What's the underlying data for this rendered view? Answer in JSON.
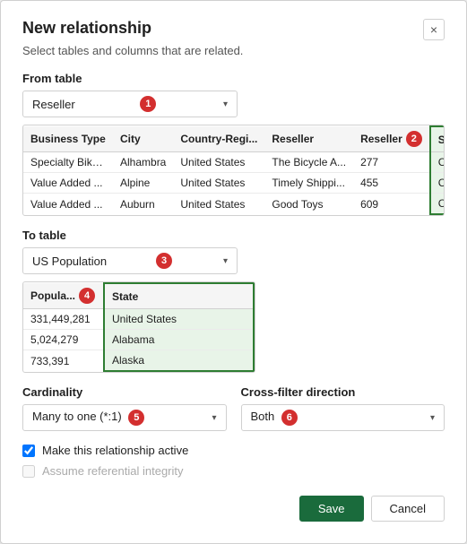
{
  "dialog": {
    "title": "New relationship",
    "subtitle": "Select tables and columns that are related.",
    "close_label": "×"
  },
  "from_table": {
    "label": "From table",
    "selected": "Reseller",
    "badge": "1",
    "columns": [
      "Business Type",
      "City",
      "Country-Regi...",
      "Reseller",
      "Reseller",
      "State-Province"
    ],
    "rows": [
      [
        "Specialty Bike...",
        "Alhambra",
        "United States",
        "The Bicycle A...",
        "277",
        "California"
      ],
      [
        "Value Added ...",
        "Alpine",
        "United States",
        "Timely Shippi...",
        "455",
        "California"
      ],
      [
        "Value Added ...",
        "Auburn",
        "United States",
        "Good Toys",
        "609",
        "California"
      ]
    ],
    "highlighted_col": 5,
    "reseller_badge": "2"
  },
  "to_table": {
    "label": "To table",
    "selected": "US Population",
    "badge": "3",
    "columns": [
      "Popula...",
      "State"
    ],
    "rows": [
      [
        "331,449,281",
        "United States"
      ],
      [
        "5,024,279",
        "Alabama"
      ],
      [
        "733,391",
        "Alaska"
      ]
    ],
    "pop_badge": "4",
    "highlighted_col": 1
  },
  "cardinality": {
    "label": "Cardinality",
    "selected": "Many to one (*:1)",
    "badge": "5"
  },
  "cross_filter": {
    "label": "Cross-filter direction",
    "selected": "Both",
    "badge": "6"
  },
  "checkboxes": {
    "active": {
      "label": "Make this relationship active",
      "checked": true,
      "disabled": false
    },
    "integrity": {
      "label": "Assume referential integrity",
      "checked": false,
      "disabled": true
    }
  },
  "footer": {
    "save_label": "Save",
    "cancel_label": "Cancel"
  }
}
